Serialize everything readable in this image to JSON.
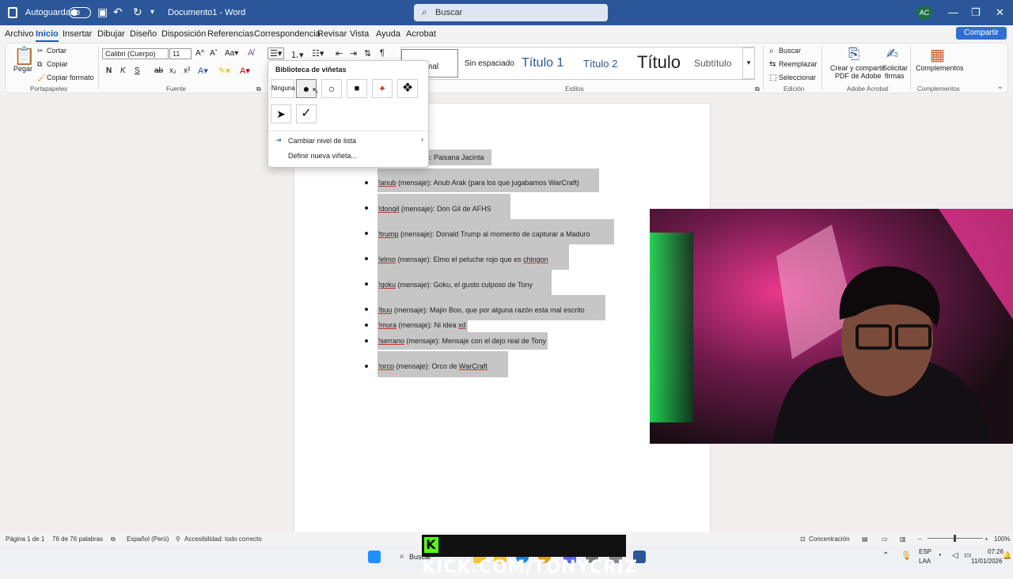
{
  "titlebar": {
    "autosave_label": "Autoguardado",
    "doc_title": "Documento1 - Word",
    "search_placeholder": "Buscar",
    "user_initials": "AC"
  },
  "menubar": {
    "tabs": [
      "Archivo",
      "Inicio",
      "Insertar",
      "Dibujar",
      "Diseño",
      "Disposición",
      "Referencias",
      "Correspondencia",
      "Revisar",
      "Vista",
      "Ayuda",
      "Acrobat"
    ],
    "active_tab": "Inicio",
    "share_label": "Compartir"
  },
  "ribbon": {
    "clipboard": {
      "paste": "Pegar",
      "cut": "Cortar",
      "copy": "Copiar",
      "format_painter": "Copiar formato",
      "group": "Portapapeles"
    },
    "font": {
      "family": "Calibri (Cuerpo)",
      "size": "11",
      "group": "Fuente"
    },
    "styles": {
      "items": [
        "Normal",
        "Sin espaciado",
        "Título 1",
        "Título 2",
        "Título",
        "Subtítulo"
      ],
      "visible_normal": "mal",
      "group": "Estilos"
    },
    "editing": {
      "find": "Buscar",
      "replace": "Reemplazar",
      "select": "Seleccionar",
      "group": "Edición"
    },
    "acrobat": {
      "create": "Crear y compartir",
      "create2": "PDF de Adobe",
      "sign": "Solicitar",
      "sign2": "firmas",
      "group": "Adobe Acrobat"
    },
    "addins": {
      "label": "Complementos",
      "group": "Complementos"
    }
  },
  "bullet_popup": {
    "title": "Biblioteca de viñetas",
    "none_label": "Ninguna",
    "change_level": "Cambiar nivel de lista",
    "define_new": "Definir nueva viñeta..."
  },
  "document": {
    "lines": [
      {
        "cmd": "",
        "rest": "): Paisana Jacinta",
        "partial": true
      },
      {
        "cmd": "!anub",
        "rest": " (mensaje): ",
        "tail": "Anub Arak (para los que jugabamos WarCraft)"
      },
      {
        "cmd": "!dongil",
        "rest": " (mensaje): Don Gil de AFHS",
        "tail": ""
      },
      {
        "cmd": "!trump",
        "rest": " (mensaje): Donald Trump al momento de capturar a Maduro",
        "tail": ""
      },
      {
        "cmd": "!elmo",
        "rest": " (mensaje): Elmo el peluche rojo que es ",
        "tail": "chingon"
      },
      {
        "cmd": "!goku",
        "rest": " (mensaje): Goku, el gusto culposo de Tony",
        "tail": ""
      },
      {
        "cmd": "!buu",
        "rest": " (mensaje): Majin Boo, que por alguna razón ",
        "tail": "esta mal escrito"
      },
      {
        "cmd": "!mura",
        "rest": " (mensaje): Ni idea ",
        "tail": "xd"
      },
      {
        "cmd": "!serrano",
        "rest": " (mensaje): Mensaje con el dejo real de Tony",
        "tail": ""
      },
      {
        "cmd": "!orco",
        "rest": " (mensaje): Orco de ",
        "tail": "WarCraft"
      }
    ]
  },
  "statusbar": {
    "page": "Página 1 de 1",
    "words": "76 de 76 palabras",
    "language": "Español (Perú)",
    "accessibility": "Accesibilidad: todo correcto",
    "focus": "Concentración",
    "zoom": "100%"
  },
  "taskbar": {
    "search": "Buscar",
    "lang1": "ESP",
    "lang2": "LAA",
    "time": "07:26",
    "date": "11/01/2026"
  },
  "overlay": {
    "stream_url": "KICK.COM/TONYCRIZ"
  }
}
